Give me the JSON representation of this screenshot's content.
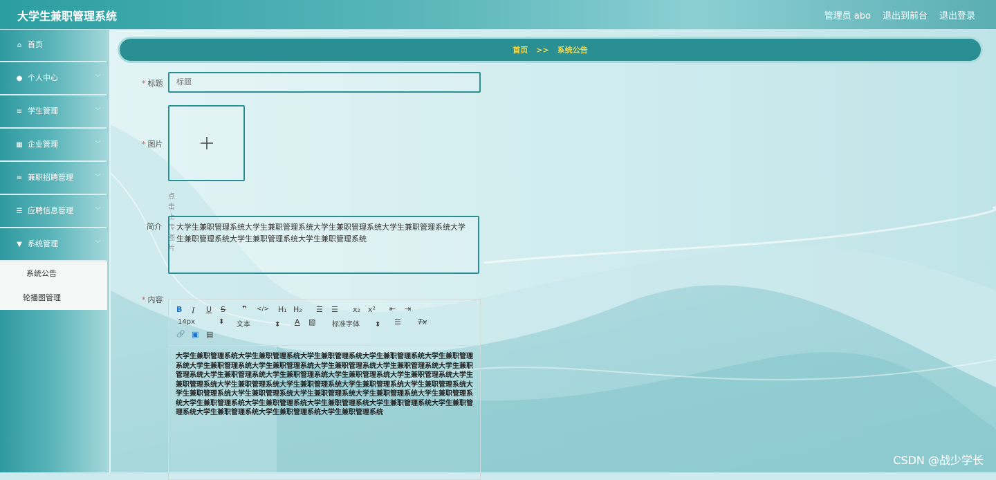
{
  "app": {
    "title": "大学生兼职管理系统"
  },
  "topbar": {
    "user": "管理员 abo",
    "front": "退出到前台",
    "logout": "退出登录"
  },
  "sidebar": {
    "items": [
      {
        "label": "首页",
        "icon": "home-icon"
      },
      {
        "label": "个人中心",
        "icon": "user-icon"
      },
      {
        "label": "学生管理",
        "icon": "list-icon"
      },
      {
        "label": "企业管理",
        "icon": "grid-icon"
      },
      {
        "label": "兼职招聘管理",
        "icon": "list-icon"
      },
      {
        "label": "应聘信息管理",
        "icon": "sliders-icon"
      },
      {
        "label": "系统管理",
        "icon": "settings-icon"
      }
    ],
    "sub_items": [
      "系统公告",
      "轮播图管理"
    ]
  },
  "breadcrumb": {
    "home": "首页",
    "sep": ">>",
    "current": "系统公告"
  },
  "form": {
    "title_label": "标题",
    "title_placeholder": "标题",
    "image_label": "图片",
    "upload_hint": "点击上传图片",
    "intro_label": "简介",
    "intro_value": "大学生兼职管理系统大学生兼职管理系统大学生兼职管理系统大学生兼职管理系统大学生兼职管理系统大学生兼职管理系统大学生兼职管理系统",
    "content_label": "内容",
    "content_value": "大学生兼职管理系统大学生兼职管理系统大学生兼职管理系统大学生兼职管理系统大学生兼职管理系统大学生兼职管理系统大学生兼职管理系统大学生兼职管理系统大学生兼职管理系统大学生兼职管理系统大学生兼职管理系统大学生兼职管理系统大学生兼职管理系统大学生兼职管理系统大学生兼职管理系统大学生兼职管理系统大学生兼职管理系统大学生兼职管理系统大学生兼职管理系统大学生兼职管理系统大学生兼职管理系统大学生兼职管理系统大学生兼职管理系统大学生兼职管理系统大学生兼职管理系统大学生兼职管理系统大学生兼职管理系统大学生兼职管理系统大学生兼职管理系统大学生兼职管理系统大学生兼职管理系统大学生兼职管理系统"
  },
  "editor": {
    "font_size": "14px",
    "block": "文本",
    "font_family": "标准字体",
    "buttons": {
      "bold": "B",
      "italic": "I",
      "underline": "U",
      "strike": "S",
      "quote": "❞",
      "code": "</>",
      "h1": "H₁",
      "h2": "H₂",
      "ol": "☰",
      "ul": "☰",
      "sub": "x₂",
      "sup": "x²",
      "indent_out": "⇤",
      "indent_in": "⇥",
      "color": "A",
      "bg": "▧",
      "align": "☰",
      "clean": "Tx",
      "link": "🔗",
      "image": "▣",
      "video": "▤"
    }
  },
  "watermark": "CSDN @战少学长"
}
